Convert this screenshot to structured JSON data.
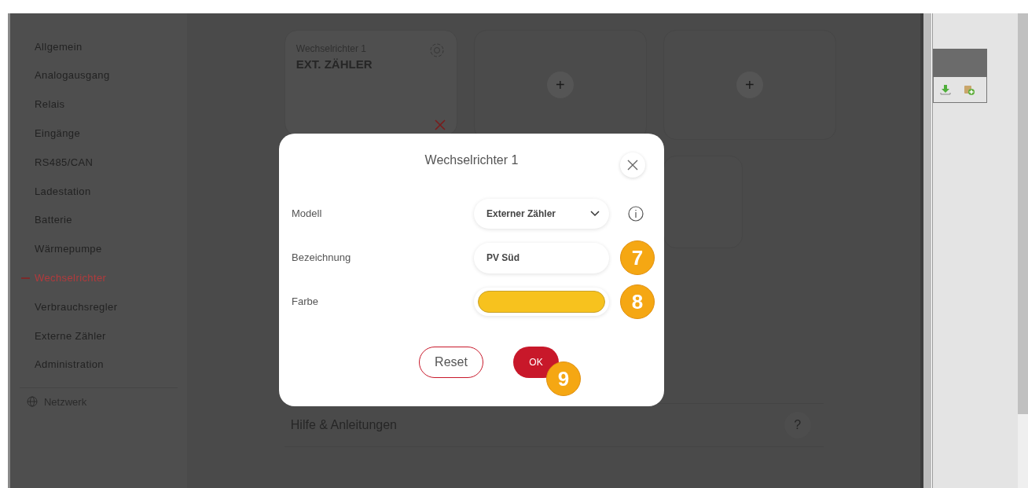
{
  "sidebar": {
    "items": [
      {
        "label": "Allgemein",
        "selected": false
      },
      {
        "label": "Analogausgang",
        "selected": false
      },
      {
        "label": "Relais",
        "selected": false
      },
      {
        "label": "Eingänge",
        "selected": false
      },
      {
        "label": "RS485/CAN",
        "selected": false
      },
      {
        "label": "Ladestation",
        "selected": false
      },
      {
        "label": "Batterie",
        "selected": false
      },
      {
        "label": "Wärmepumpe",
        "selected": false
      },
      {
        "label": "Wechselrichter",
        "selected": true
      },
      {
        "label": "Verbrauchsregler",
        "selected": false
      },
      {
        "label": "Externe Zähler",
        "selected": false
      },
      {
        "label": "Administration",
        "selected": false
      }
    ],
    "network": {
      "label": "Netzwerk"
    }
  },
  "cards": [
    {
      "kind": "device",
      "subtitle": "Wechselrichter 1",
      "title": "EXT. ZÄHLER"
    },
    {
      "kind": "add",
      "label": "+"
    },
    {
      "kind": "add",
      "label": "+"
    },
    {
      "kind": "empty"
    }
  ],
  "help": {
    "label": "Hilfe & Anleitungen",
    "icon": "?"
  },
  "dialog": {
    "title": "Wechselrichter 1",
    "fields": [
      {
        "kind": "select",
        "label": "Modell",
        "value": "Externer Zähler",
        "info": true
      },
      {
        "kind": "text",
        "label": "Bezeichnung",
        "value": "PV Süd",
        "badge": "7"
      },
      {
        "kind": "color",
        "label": "Farbe",
        "color": "#f7c21e",
        "badge": "8"
      }
    ],
    "buttons": [
      {
        "kind": "secondary",
        "label": "Reset"
      },
      {
        "kind": "primary",
        "label": "OK",
        "badge": "9"
      }
    ]
  }
}
